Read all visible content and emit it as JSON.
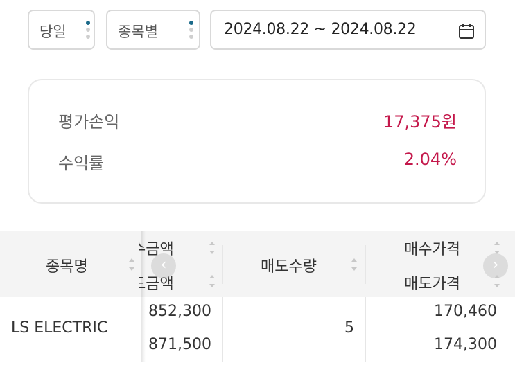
{
  "filters": {
    "period": "당일",
    "group": "종목별",
    "date_range": "2024.08.22 ~ 2024.08.22"
  },
  "summary": {
    "pl_label": "평가손익",
    "pl_value": "17,375원",
    "rate_label": "수익률",
    "rate_value": "2.04%",
    "accent_color": "#c4184b"
  },
  "table": {
    "headers": {
      "name": "종목명",
      "amount_top": "수금액",
      "amount_bottom": "도금액",
      "sell_qty": "매도수량",
      "buy_price": "매수가격",
      "sell_price": "매도가격"
    },
    "rows": [
      {
        "name": "LS ELECTRIC",
        "amount_top": "852,300",
        "amount_bottom": "871,500",
        "sell_qty": "5",
        "buy_price": "170,460",
        "sell_price": "174,300"
      }
    ],
    "icons": {
      "scroll_left": "chevron-left-icon",
      "scroll_right": "chevron-right-icon",
      "calendar": "calendar-icon"
    }
  }
}
